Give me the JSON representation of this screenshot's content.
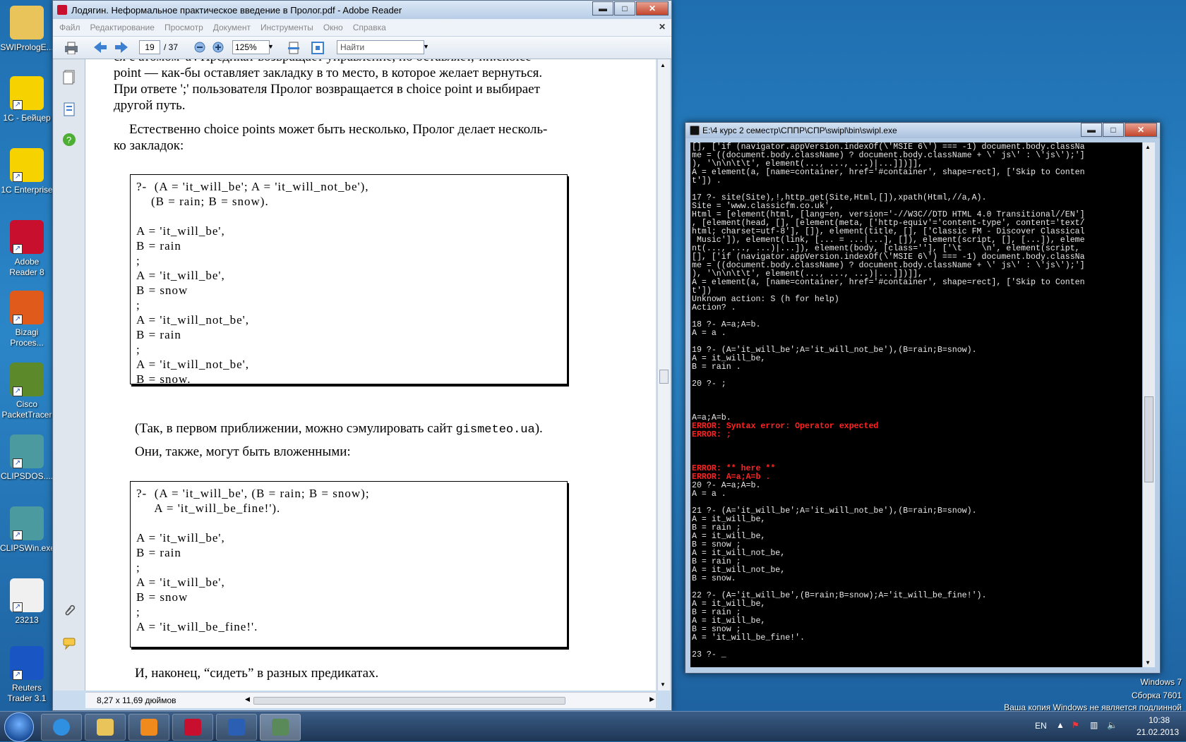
{
  "desktop": {
    "icons": [
      {
        "label": "SWIPrologE...",
        "color": "#e8c45a"
      },
      {
        "label": "1C - Бейцер",
        "color": "#f6d300"
      },
      {
        "label": "1C Enterprise",
        "color": "#f6d300"
      },
      {
        "label": "Adobe Reader 8",
        "color": "#c8102e"
      },
      {
        "label": "Bizagi Proces...",
        "color": "#e05a1c"
      },
      {
        "label": "Cisco PacketTracer",
        "color": "#5c8a2a"
      },
      {
        "label": "CLIPSDOS....",
        "color": "#4a9aa0"
      },
      {
        "label": "CLIPSWin.exe",
        "color": "#4a9aa0"
      },
      {
        "label": "23213",
        "color": "#f0f0f0"
      },
      {
        "label": "Reuters Trader 3.1",
        "color": "#1a55c4"
      }
    ]
  },
  "adobe": {
    "title": "Лодягин. Неформальное практическое введение в Пролог.pdf - Adobe Reader",
    "menu": [
      "Файл",
      "Редактирование",
      "Просмотр",
      "Документ",
      "Инструменты",
      "Окно",
      "Справка"
    ],
    "toolbar": {
      "page": "19",
      "page_total": "/ 37",
      "zoom": "125%",
      "find_placeholder": "Найти"
    },
    "status_size": "8,27 x 11,69 дюймов",
    "doc": {
      "p1_line0": "ся с атомом 'а'. Предикат возвращает управление, но оставляет, т.н.choice",
      "p1_line1": "point — как-бы оставляет закладку в то место, в которое желает вернуться.",
      "p1_line2": "При ответе ';' пользователя Пролог возвращается в choice point и выбирает",
      "p1_line3": "другой путь.",
      "p2_line1": "Естественно choice points может быть несколько, Пролог делает несколь-",
      "p2_line2": "ко закладок:",
      "code1": "?-  (A = 'it_will_be'; A = 'it_will_not_be'),\n    (B = rain; B = snow).\n\nA = 'it_will_be',\nB = rain\n;\nA = 'it_will_be',\nB = snow\n;\nA = 'it_will_not_be',\nB = rain\n;\nA = 'it_will_not_be',\nB = snow.",
      "p3_prefix": "(Так, в первом приближении, можно сэмулировать сайт ",
      "p3_site": "gismeteo.ua",
      "p3_suffix": ").",
      "p4": "Они, также, могут быть вложенными:",
      "code2": "?-  (A = 'it_will_be', (B = rain; B = snow);\n     A = 'it_will_be_fine!').\n\nA = 'it_will_be',\nB = rain\n;\nA = 'it_will_be',\nB = snow\n;\nA = 'it_will_be_fine!'.",
      "p5": "И, наконец, “сидеть” в разных предикатах."
    }
  },
  "console": {
    "title": "E:\\4 курс 2 семестр\\СППР\\СПР\\swipl\\bin\\swipl.exe",
    "text_a": "[], ['if (navigator.appVersion.indexOf(\\'MSIE 6\\') === -1) document.body.classNa\nme = ((document.body.className) ? document.body.className + \\' js\\' : \\'js\\');']\n), '\\n\\n\\t\\t', element(..., ..., ...)|...]])]],\nA = element(a, [name=container, href='#container', shape=rect], ['Skip to Conten\nt']) .\n\n17 ?- site(Site),!,http_get(Site,Html,[]),xpath(Html,//a,A).\nSite = 'www.classicfm.co.uk',\nHtml = [element(html, [lang=en, version='-//W3C//DTD HTML 4.0 Transitional//EN']\n, [element(head, [], [element(meta, ['http-equiv'='content-type', content='text/\nhtml; charset=utf-8'], []), element(title, [], ['Classic FM - Discover Classical\n Music']), element(link, [... = ...|...], []), element(script, [], [...]), eleme\nnt(..., ..., ...)|...]), element(body, [class=''], ['\\t    \\n', element(script,\n[], ['if (navigator.appVersion.indexOf(\\'MSIE 6\\') === -1) document.body.classNa\nme = ((document.body.className) ? document.body.className + \\' js\\' : \\'js\\');']\n), '\\n\\n\\t\\t', element(..., ..., ...)|...]])]],\nA = element(a, [name=container, href='#container', shape=rect], ['Skip to Conten\nt'])\nUnknown action: S (h for help)\nAction? .\n\n18 ?- A=a;A=b.\nA = a .\n\n19 ?- (A='it_will_be';A='it_will_not_be'),(B=rain;B=snow).\nA = it_will_be,\nB = rain .\n\n20 ?- ;\n\n\n\nA=a;A=b.",
    "err_a": "ERROR: Syntax error: Operator expected\nERROR: ;",
    "err_b": "ERROR: ** here **\nERROR: A=a;A=b .",
    "text_b": "20 ?- A=a;A=b.\nA = a .\n\n21 ?- (A='it_will_be';A='it_will_not_be'),(B=rain;B=snow).\nA = it_will_be,\nB = rain ;\nA = it_will_be,\nB = snow ;\nA = it_will_not_be,\nB = rain ;\nA = it_will_not_be,\nB = snow.\n\n22 ?- (A='it_will_be',(B=rain;B=snow);A='it_will_be_fine!').\nA = it_will_be,\nB = rain ;\nA = it_will_be,\nB = snow ;\nA = 'it_will_be_fine!'.\n\n23 ?- _"
  },
  "system": {
    "watermark_line1": "Windows 7",
    "watermark_line2": "Сборка 7601",
    "watermark_line3": "Ваша копия Windows не является подлинной",
    "lang": "EN",
    "time": "10:38",
    "date": "21.02.2013"
  }
}
